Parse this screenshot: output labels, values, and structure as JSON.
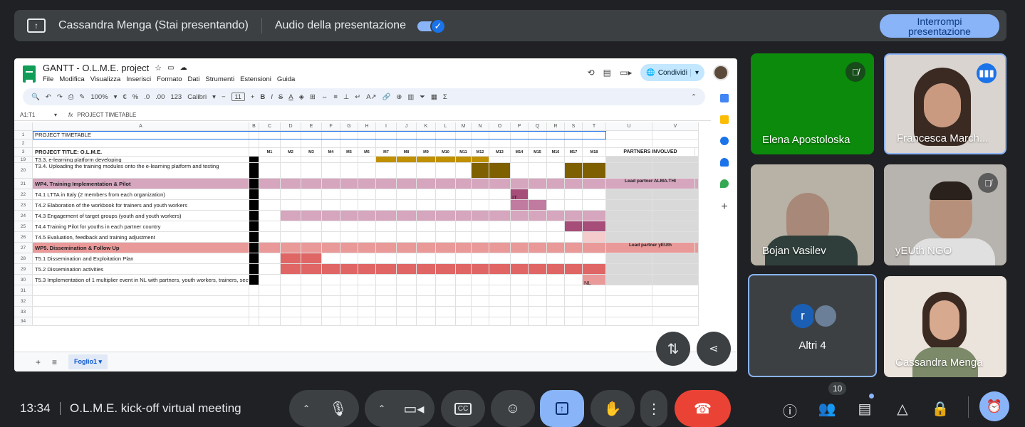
{
  "banner": {
    "presenter": "Cassandra Menga (Stai presentando)",
    "audio_label": "Audio della presentazione",
    "stop_label_1": "Interrompi",
    "stop_label_2": "presentazione"
  },
  "sheet": {
    "title": "GANTT - O.L.M.E. project",
    "menu": [
      "File",
      "Modifica",
      "Visualizza",
      "Inserisci",
      "Formato",
      "Dati",
      "Strumenti",
      "Estensioni",
      "Guida"
    ],
    "share_label": "Condividi",
    "toolbar": {
      "zoom": "100%",
      "currency": "€",
      "percent": "%",
      "dec_less": ".0",
      "dec_more": ".00",
      "fmt123": "123",
      "font": "Calibri",
      "size": "11"
    },
    "cellref": "A1:T1",
    "fx": "fx",
    "formula": "PROJECT TIMETABLE",
    "columns": [
      "A",
      "B",
      "C",
      "D",
      "E",
      "F",
      "G",
      "H",
      "I",
      "J",
      "K",
      "L",
      "M",
      "N",
      "O",
      "P",
      "Q",
      "R",
      "S",
      "T",
      "U",
      "V"
    ],
    "months": [
      "M1",
      "M2",
      "M3",
      "M4",
      "M5",
      "M6",
      "M7",
      "M8",
      "M9",
      "M10",
      "M11",
      "M12",
      "M13",
      "M14",
      "M15",
      "M16",
      "M17",
      "M18"
    ],
    "partners_header": "PARTNERS INVOLVED",
    "rows": [
      {
        "num": "1",
        "text": "PROJECT TIMETABLE"
      },
      {
        "num": "2",
        "text": ""
      },
      {
        "num": "3",
        "text": "PROJECT TITLE: O.L.M.E."
      },
      {
        "num": "19",
        "text": "T3.3. e-learning platform developing"
      },
      {
        "num": "20",
        "text": "T3.4. Uploading the training modules onto the e-learning platform and testing"
      },
      {
        "num": "21",
        "text": "WP4.  Training Implementation & Pilot",
        "partner": "Lead partner ALMA.THI"
      },
      {
        "num": "22",
        "text": "T4.1 LTTA in Italy (2 members from each organization)",
        "mark": "IT"
      },
      {
        "num": "23",
        "text": "T4.2 Elaboration of the workbook for trainers and youth workers"
      },
      {
        "num": "24",
        "text": "T4.3 Engagement of target groups (youth and youth workers)"
      },
      {
        "num": "25",
        "text": "T4.4 Training Pilot for youths in each partner country"
      },
      {
        "num": "26",
        "text": "T4.5 Evaluation, feedback and training adjustment"
      },
      {
        "num": "27",
        "text": "WP5. Dissemination & Follow Up",
        "partner": "Lead partner yEUth"
      },
      {
        "num": "28",
        "text": "T5.1 Dissemination and Exploitation Plan"
      },
      {
        "num": "29",
        "text": "T5.2 Dissemination activities"
      },
      {
        "num": "30",
        "text": "T5.3 Implementation of 1 multiplier event in NL with partners, youth workers, trainers, sectorial experts, stakeholders and policy makers",
        "mark": "NL"
      },
      {
        "num": "31",
        "text": ""
      },
      {
        "num": "32",
        "text": ""
      },
      {
        "num": "33",
        "text": ""
      },
      {
        "num": "34",
        "text": ""
      }
    ],
    "tab_name": "Foglio1"
  },
  "participants": [
    {
      "name": "Elena Apostoloska"
    },
    {
      "name": "Francesca March..."
    },
    {
      "name": "Bojan Vasilev"
    },
    {
      "name": "yEUth NGO"
    },
    {
      "name": "Altri 4",
      "initial": "r"
    },
    {
      "name": "Cassandra Menga"
    }
  ],
  "bottom": {
    "time": "13:34",
    "meeting": "O.L.M.E. kick-off virtual meeting",
    "people_count": "10"
  },
  "colors": {
    "wp4": "#d5a6bd",
    "wp4_dark": "#a64d79",
    "wp4_mid": "#c27ba0",
    "wp5": "#ea9999",
    "wp5_dark": "#e06666",
    "brown": "#7f6000",
    "gold": "#bf9000",
    "grey": "#d9d9d9",
    "black": "#000000"
  }
}
